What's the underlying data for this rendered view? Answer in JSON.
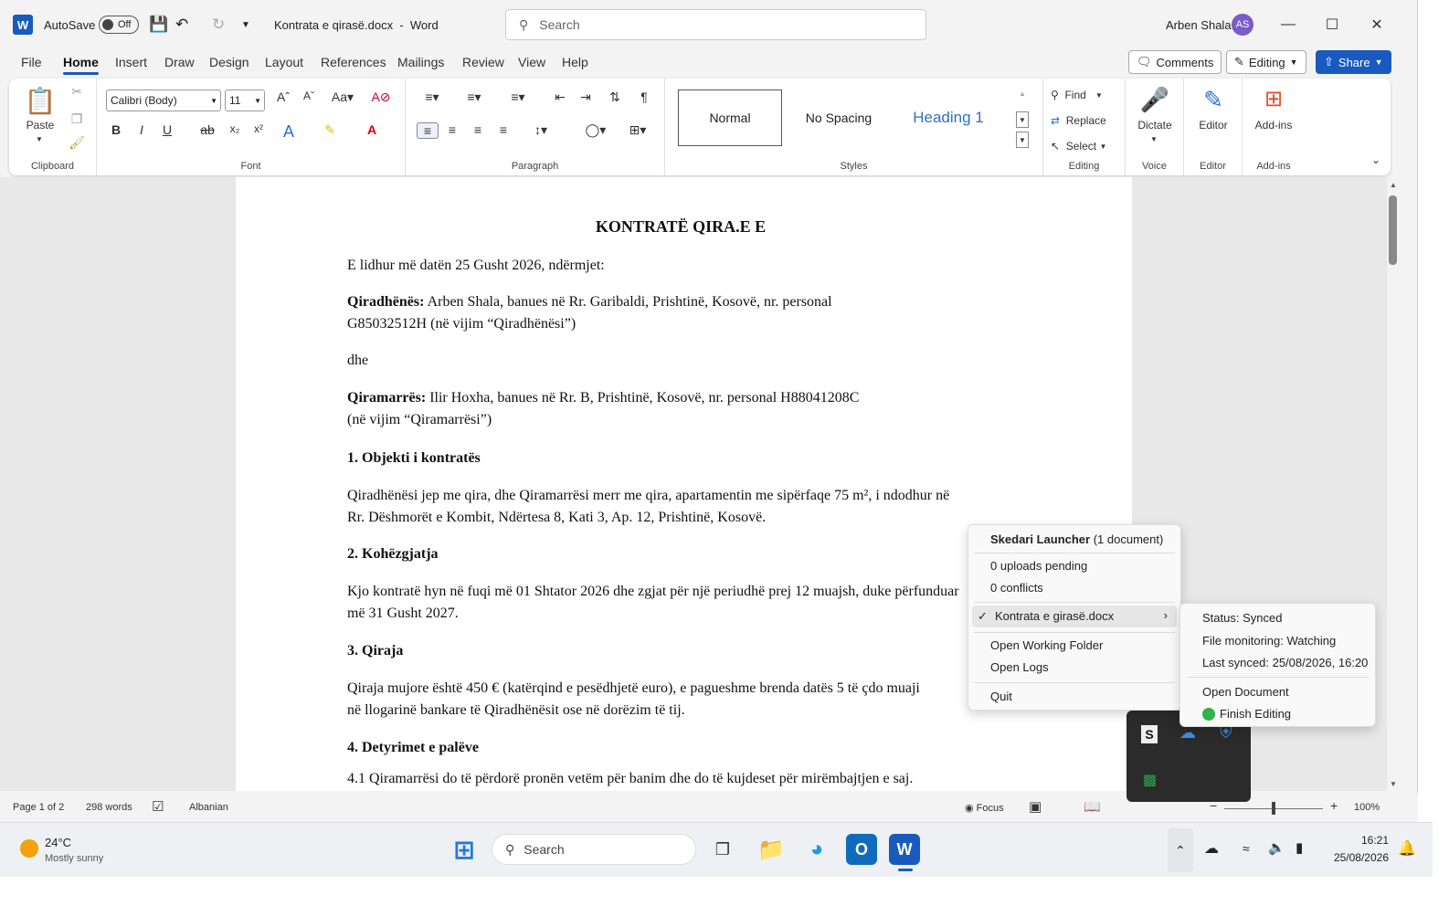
{
  "titlebar": {
    "autosave": "AutoSave",
    "autosave_state": "Off",
    "doc_title": "Kontrata e qirasë.docx",
    "app_sep": "-",
    "app": "Word",
    "search_placeholder": "Search",
    "user": "Arben Shala",
    "initials": "AS"
  },
  "menu": [
    "File",
    "Home",
    "Insert",
    "Draw",
    "Design",
    "Layout",
    "References",
    "Mailings",
    "Review",
    "View",
    "Help"
  ],
  "actions": {
    "comments": "Comments",
    "editing": "Editing",
    "share": "Share"
  },
  "ribbon": {
    "paste": "Paste",
    "clipboard": "Clipboard",
    "font_name": "Calibri (Body)",
    "font_size": "11",
    "font": "Font",
    "paragraph": "Paragraph",
    "styles": [
      "Normal",
      "No Spacing",
      "Heading 1"
    ],
    "styles_label": "Styles",
    "find": "Find",
    "replace": "Replace",
    "select": "Select",
    "editing_label": "Editing",
    "dictate": "Dictate",
    "voice": "Voice",
    "editor": "Editor",
    "editor_label": "Editor",
    "addins": "Add-ins",
    "addins_label": "Add-ins"
  },
  "doc": {
    "title": "KONTRATË QIRA.E E",
    "intro": "E lidhur  më datën 25 Gusht 2026, ndërmjet:",
    "landlord_label": "Qiradhënës:",
    "landlord_1": " Arben Shala, banues në Rr. Garibaldi, Prishtinë, Kosovë, nr. personal",
    "landlord_2": "G85032512H (në vijim “Qiradhënësi”)",
    "and": "dhe",
    "tenant_label": "Qiramarrës:",
    "tenant_1": " Ilir Hoxha, banues në Rr. B, Prishtinë, Kosovë, nr. personal H88041208C",
    "tenant_2": "(në vijim “Qiramarrësi”)",
    "s1": "1. Objekti i kontratës",
    "s1_1": "Qiradhënësi jep me qira, dhe Qiramarrësi merr me qira, apartamentin me sipërfaqe 75 m², i ndodhur në",
    "s1_2": "Rr. Dëshmorët e Kombit, Ndërtesa 8, Kati 3, Ap. 12, Prishtinë, Kosovë.",
    "s2": "2. Kohëzgjatja",
    "s2_1": "Kjo kontratë hyn në fuqi më 01 Shtator 2026 dhe zgjat për një periudhë prej 12 muajsh, duke përfunduar",
    "s2_2": "më 31 Gusht 2027.",
    "s3": "3. Qiraja",
    "s3_1": "Qiraja mujore është 450 € (katërqind e pesëdhjetë euro), e pagueshme brenda datës 5 të çdo muaji",
    "s3_2": "në llogarinë bankare të Qiradhënësit ose në dorëzim të tij.",
    "s4": "4. Detyrimet e palëve",
    "s4_1": "4.1  Qiramarrësi do të përdorë pronën vetëm për banim dhe do të kujdeset për mirëmbajtjen e saj."
  },
  "status": {
    "page": "Page 1 of 2",
    "words": "298 words",
    "lang": "Albanian",
    "focus": "Focus",
    "zoom": "100%"
  },
  "menu_popup": {
    "header": "Skedari Launcher",
    "header_count": " (1 document)",
    "uploads": "0 uploads pending",
    "conflicts": "0 conflicts",
    "file": "Kontrata e girasë.docx",
    "open_folder": "Open Working Folder",
    "open_logs": "Open Logs",
    "quit": "Quit"
  },
  "submenu": {
    "status": "Status: Synced",
    "monitoring": "File monitoring: Watching",
    "last_synced": "Last synced: 25/08/2026, 16:20",
    "open_doc": "Open Document",
    "finish": "Finish Editing"
  },
  "taskbar": {
    "temp": "24°C",
    "weather": "Mostly sunny",
    "search": "Search",
    "time": "16:21",
    "date": "25/08/2026"
  }
}
